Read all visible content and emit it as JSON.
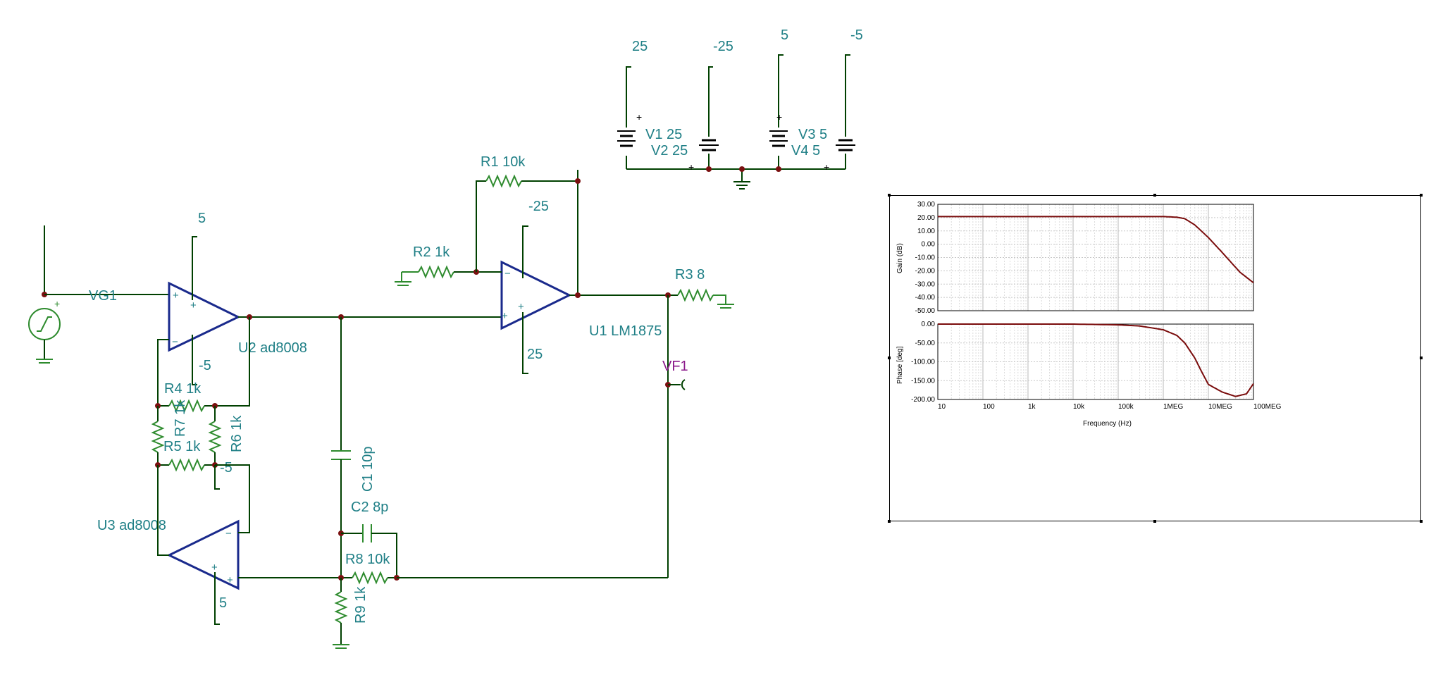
{
  "schematic": {
    "supply_labels": {
      "v1_node": "25",
      "v2_node": "-25",
      "v3_node": "5",
      "v4_node": "-5"
    },
    "sources": {
      "v1": "V1 25",
      "v2": "V2 25",
      "v3": "V3 5",
      "v4": "V4 5"
    },
    "components": {
      "r1": "R1 10k",
      "r2": "R2 1k",
      "r3": "R3 8",
      "r4": "R4 1k",
      "r5": "R5 1k",
      "r6": "R6 1k",
      "r7": "R7 1k",
      "r8": "R8 10k",
      "r9": "R9 1k",
      "c1": "C1 10p",
      "c2": "C2 8p",
      "u1": "U1 LM1875",
      "u2": "U2 ad8008",
      "u3": "U3 ad8008"
    },
    "probes": {
      "vg1": "VG1",
      "vf1": "VF1"
    },
    "rail_labels": {
      "u2_top": "5",
      "u2_bottom": "-5",
      "u1_top": "-25",
      "u1_bottom": "25",
      "u3_top": "-5",
      "u3_bottom": "5"
    }
  },
  "bode_plot": {
    "gain_axis_title": "Gain (dB)",
    "phase_axis_title": "Phase [deg]",
    "x_axis_title": "Frequency (Hz)",
    "gain_ticks": [
      "30.00",
      "20.00",
      "10.00",
      "0.00",
      "-10.00",
      "-20.00",
      "-30.00",
      "-40.00",
      "-50.00"
    ],
    "phase_ticks": [
      "0.00",
      "-50.00",
      "-100.00",
      "-150.00",
      "-200.00"
    ],
    "freq_ticks": [
      "10",
      "100",
      "1k",
      "10k",
      "100k",
      "1MEG",
      "10MEG",
      "100MEG"
    ],
    "trace_color": "#7a0c0c"
  },
  "chart_data": [
    {
      "type": "line",
      "title": "",
      "xlabel": "Frequency (Hz)",
      "ylabel": "Gain (dB)",
      "xscale": "log",
      "xlim": [
        10,
        100000000
      ],
      "ylim": [
        -50,
        30
      ],
      "grid": true,
      "series": [
        {
          "x": [
            10,
            100,
            1000,
            10000,
            100000,
            1000000,
            2000000,
            3000000,
            5000000,
            10000000,
            20000000,
            50000000,
            100000000
          ],
          "values": [
            20.8,
            20.8,
            20.8,
            20.8,
            20.8,
            20.8,
            20.3,
            19.2,
            14.5,
            5.0,
            -6.0,
            -21.0,
            -29.0
          ]
        }
      ]
    },
    {
      "type": "line",
      "title": "",
      "xlabel": "Frequency (Hz)",
      "ylabel": "Phase [deg]",
      "xscale": "log",
      "xlim": [
        10,
        100000000
      ],
      "ylim": [
        -200,
        0
      ],
      "grid": true,
      "series": [
        {
          "x": [
            10,
            100,
            1000,
            10000,
            100000,
            300000,
            1000000,
            2000000,
            3000000,
            5000000,
            7000000,
            10000000,
            20000000,
            40000000,
            70000000,
            100000000
          ],
          "values": [
            0,
            0,
            0,
            0,
            -2,
            -5,
            -15,
            -30,
            -50,
            -90,
            -125,
            -160,
            -180,
            -192,
            -185,
            -158
          ]
        }
      ]
    }
  ]
}
